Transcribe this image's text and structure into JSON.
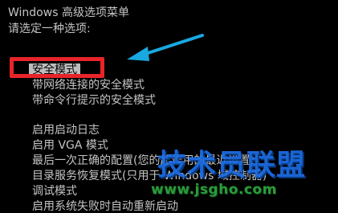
{
  "header": {
    "title": "Windows 高级选项菜单",
    "prompt": "请选定一种选项:"
  },
  "menu": {
    "items": [
      {
        "label": "安全模式",
        "selected": true
      },
      {
        "label": "带网络连接的安全模式",
        "selected": false
      },
      {
        "label": "带命令行提示的安全模式",
        "selected": false
      },
      {
        "label": "启用启动日志",
        "selected": false
      },
      {
        "label": "启用 VGA 模式",
        "selected": false
      },
      {
        "label": "最后一次正确的配置(您的起作用的最近设置)",
        "selected": false
      },
      {
        "label": "目录服务恢复模式(只用于 Windows 域控制器)",
        "selected": false
      },
      {
        "label": "调试模式",
        "selected": false
      },
      {
        "label": "启用系统失败时自动重新启动",
        "selected": false
      }
    ]
  },
  "annotations": {
    "highlight_color": "#e8242a",
    "arrow_color": "#19a8e0"
  },
  "watermark": {
    "brand": "技术员联盟",
    "url": "www.jsgho.com"
  },
  "colors": {
    "background": "#000000",
    "text": "#c4c4c4",
    "selection_bg": "#bdbdbd",
    "watermark_blue": "#1d6ee6",
    "watermark_green": "#2b9a3a"
  }
}
